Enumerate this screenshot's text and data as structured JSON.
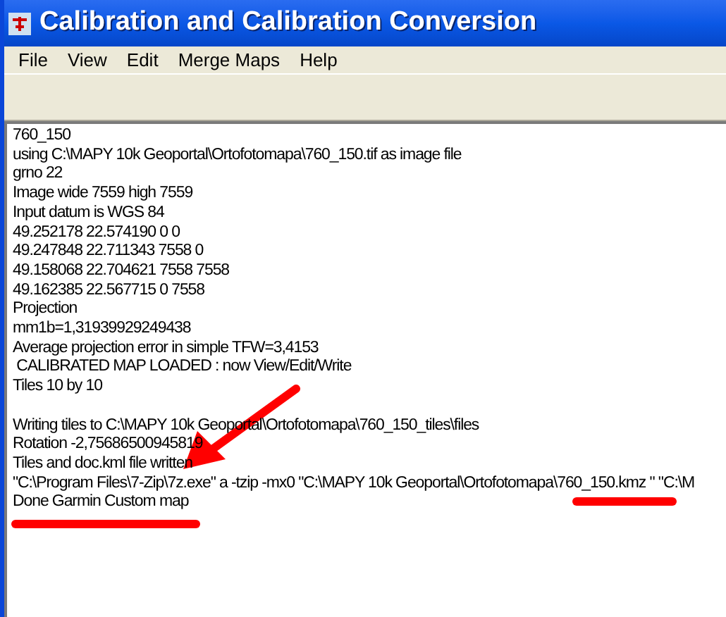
{
  "window": {
    "title": "Calibration and Calibration Conversion"
  },
  "menu": [
    "File",
    "View",
    "Edit",
    "Merge Maps",
    "Help"
  ],
  "log": [
    {
      "text": "760_150",
      "gap_before": false
    },
    {
      "text": "using C:\\MAPY 10k Geoportal\\Ortofotomapa\\760_150.tif as image file",
      "gap_before": false
    },
    {
      "text": "grno 22",
      "gap_before": false
    },
    {
      "text": "Image wide 7559 high 7559",
      "gap_before": false
    },
    {
      "text": "Input datum is WGS 84",
      "gap_before": false
    },
    {
      "text": "49.252178 22.574190 0 0",
      "gap_before": false
    },
    {
      "text": "49.247848 22.711343 7558 0",
      "gap_before": false
    },
    {
      "text": "49.158068 22.704621 7558 7558",
      "gap_before": false
    },
    {
      "text": "49.162385 22.567715 0 7558",
      "gap_before": false
    },
    {
      "text": "Projection",
      "gap_before": false
    },
    {
      "text": "mm1b=1,31939929249438",
      "gap_before": false
    },
    {
      "text": "Average projection error in simple TFW=3,4153",
      "gap_before": false
    },
    {
      "text": " CALIBRATED MAP LOADED : now View/Edit/Write",
      "gap_before": false
    },
    {
      "text": "Tiles 10 by 10",
      "gap_before": false
    },
    {
      "text": "Writing tiles to C:\\MAPY 10k Geoportal\\Ortofotomapa\\760_150_tiles\\files",
      "gap_before": true
    },
    {
      "text": "Rotation -2,75686500945819",
      "gap_before": false
    },
    {
      "text": "Tiles and doc.kml file written",
      "gap_before": false
    },
    {
      "text": "\"C:\\Program Files\\7-Zip\\7z.exe\" a -tzip -mx0 \"C:\\MAPY 10k Geoportal\\Ortofotomapa\\760_150.kmz \" \"C:\\M",
      "gap_before": false
    },
    {
      "text": "Done Garmin Custom map",
      "gap_before": false
    }
  ]
}
